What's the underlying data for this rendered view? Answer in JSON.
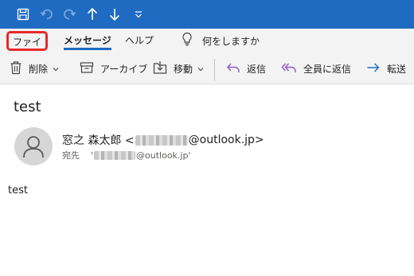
{
  "quick_access": {
    "icons": [
      "save-icon",
      "undo-icon",
      "redo-icon",
      "up-arrow-icon",
      "down-arrow-icon",
      "customize-icon"
    ]
  },
  "tabs": {
    "file": "ファイル",
    "message": "メッセージ",
    "help": "ヘルプ"
  },
  "tell_me": {
    "label": "何をしますか",
    "icon": "lightbulb-icon"
  },
  "commands": {
    "delete": "削除",
    "archive": "アーカイブ",
    "move": "移動",
    "reply": "返信",
    "reply_all": "全員に返信",
    "forward": "転送"
  },
  "message": {
    "subject": "test",
    "sender_name": "窓之 森太郎 <",
    "sender_domain": "@outlook.jp>",
    "to_label": "宛先",
    "to_prefix": "'",
    "to_domain": "@outlook.jp'",
    "body": "test"
  },
  "colors": {
    "titlebar": "#1f6bc2",
    "ribbon": "#f3f3f3",
    "highlight": "#e8282b",
    "accent": "#1f6bc2"
  }
}
